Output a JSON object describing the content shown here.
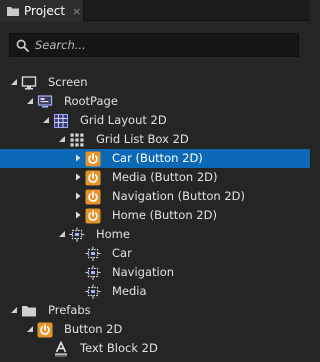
{
  "panel": {
    "tab_title": "Project",
    "close_glyph": "×"
  },
  "search": {
    "placeholder": "Search...",
    "value": ""
  },
  "colors": {
    "background": "#252526",
    "selection": "#0c69b5",
    "button_icon": "#e8922a",
    "layout_icon": "#8aa4ff"
  },
  "tree": [
    {
      "label": "Screen",
      "icon": "monitor-icon",
      "depth": 0,
      "expanded": true
    },
    {
      "label": "RootPage",
      "icon": "page-icon",
      "depth": 1,
      "expanded": true
    },
    {
      "label": "Grid Layout 2D",
      "icon": "grid-layout-icon",
      "depth": 2,
      "expanded": true
    },
    {
      "label": "Grid List Box 2D",
      "icon": "grid-list-box-icon",
      "depth": 3,
      "expanded": true
    },
    {
      "label": "Car (Button 2D)",
      "icon": "power-button-icon",
      "depth": 4,
      "expanded": false,
      "selected": true
    },
    {
      "label": "Media (Button 2D)",
      "icon": "power-button-icon",
      "depth": 4,
      "expanded": false
    },
    {
      "label": "Navigation (Button 2D)",
      "icon": "power-button-icon",
      "depth": 4,
      "expanded": false
    },
    {
      "label": "Home (Button 2D)",
      "icon": "power-button-icon",
      "depth": 4,
      "expanded": false
    },
    {
      "label": "Home",
      "icon": "node-icon",
      "depth": 3,
      "expanded": true
    },
    {
      "label": "Car",
      "icon": "node-icon",
      "depth": 4
    },
    {
      "label": "Navigation",
      "icon": "node-icon",
      "depth": 4
    },
    {
      "label": "Media",
      "icon": "node-icon",
      "depth": 4
    },
    {
      "label": "Prefabs",
      "icon": "folder-icon",
      "depth": 0,
      "expanded": true
    },
    {
      "label": "Button 2D",
      "icon": "power-button-icon",
      "depth": 1,
      "expanded": true
    },
    {
      "label": "Text Block 2D",
      "icon": "text-block-icon",
      "depth": 2
    }
  ]
}
